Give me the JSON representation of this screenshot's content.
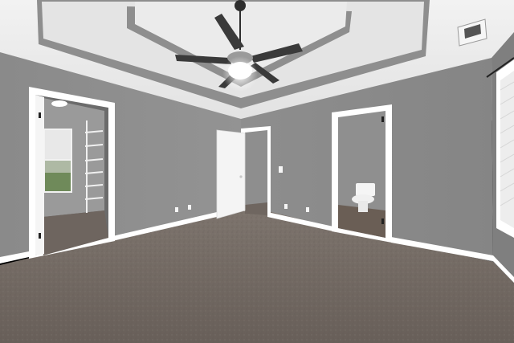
{
  "scene": {
    "description_kind": "interior-photo",
    "colors": {
      "wall": "#8c8c8c",
      "wall_shadow": "#7e7e7e",
      "ceiling": "#e9e9e9",
      "tray_band": "#8e8e8e",
      "trim": "#ffffff",
      "carpet": "#6f6660",
      "door": "#f4f4f4",
      "fan_blade": "#3b3b3b"
    }
  }
}
